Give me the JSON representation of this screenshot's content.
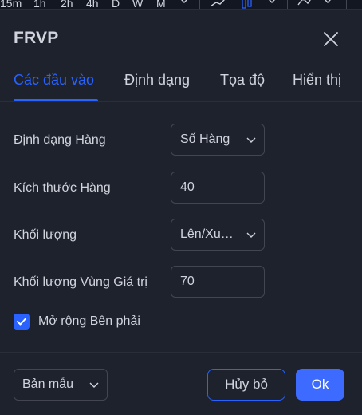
{
  "toolbar": {
    "timeframes": [
      "15m",
      "1h",
      "2h",
      "4h",
      "D",
      "W",
      "M"
    ]
  },
  "dialog": {
    "title": "FRVP",
    "tabs": [
      {
        "label": "Các đầu vào",
        "active": true
      },
      {
        "label": "Định dạng",
        "active": false
      },
      {
        "label": "Tọa độ",
        "active": false
      },
      {
        "label": "Hiển thị",
        "active": false
      }
    ],
    "fields": {
      "row_layout": {
        "label": "Định dạng Hàng",
        "value": "Số Hàng",
        "type": "select"
      },
      "row_size": {
        "label": "Kích thước Hàng",
        "value": "40",
        "type": "input"
      },
      "volume": {
        "label": "Khối lượng",
        "value": "Lên/Xu…",
        "type": "select"
      },
      "value_area_volume": {
        "label": "Khối lượng Vùng Giá trị",
        "value": "70",
        "type": "input"
      }
    },
    "extend_right": {
      "label": "Mở rộng Bên phải",
      "checked": true
    },
    "footer": {
      "template_label": "Bản mẫu",
      "cancel_label": "Hủy bỏ",
      "ok_label": "Ok"
    }
  },
  "colors": {
    "background": "#1e222d",
    "accent": "#2962ff",
    "ok_button": "#3d6bff",
    "text": "#d1d4dc",
    "border": "#434651"
  }
}
